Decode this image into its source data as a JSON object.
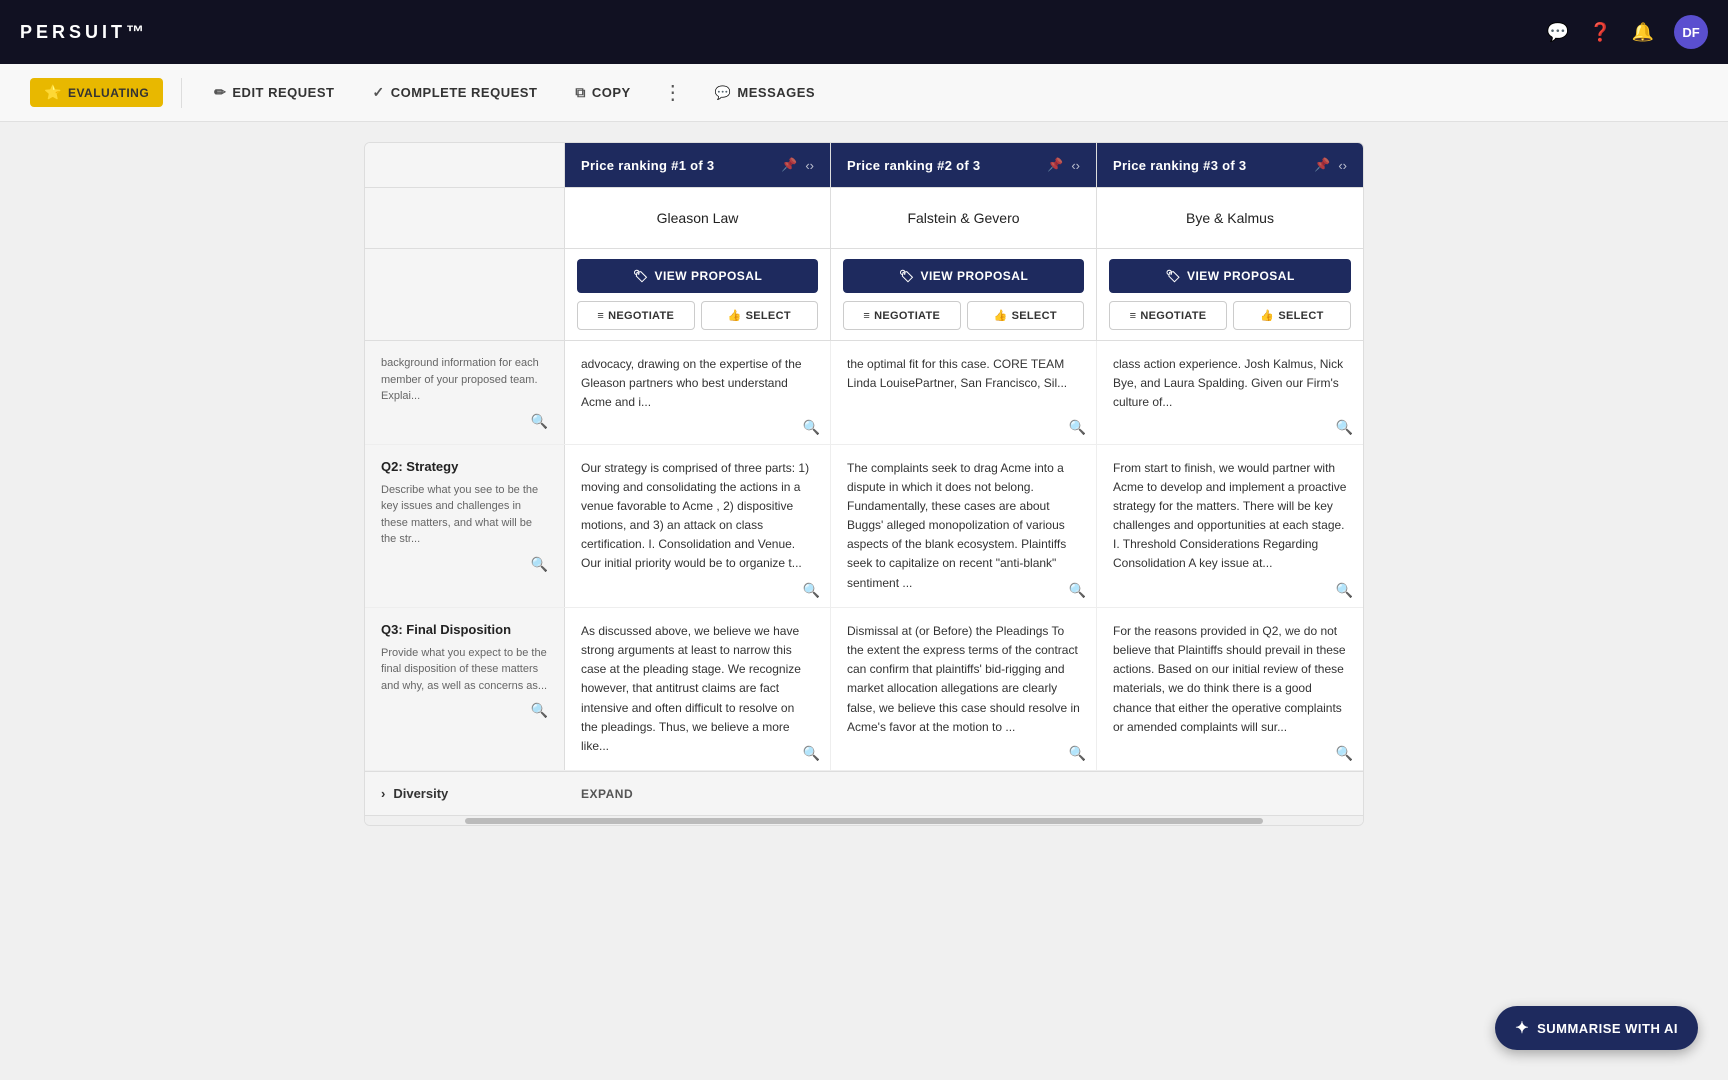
{
  "topbar": {
    "logo": "PERSUIT™",
    "icons": [
      "chat-icon",
      "help-icon",
      "notifications-icon"
    ],
    "avatar_initials": "DF"
  },
  "actionbar": {
    "status_badge": "EVALUATING",
    "edit_request_label": "EDIT REQUEST",
    "complete_request_label": "COMPLETE REQUEST",
    "copy_label": "COPY",
    "messages_label": "MESSAGES"
  },
  "columns": [
    {
      "ranking": "Price ranking #1 of 3",
      "firm": "Gleason Law",
      "q1_text": "advocacy, drawing on the expertise of the Gleason partners who best understand Acme and i...",
      "q2_text": "Our strategy is comprised of three parts: 1) moving and consolidating the actions in a venue favorable to Acme , 2) dispositive motions, and 3) an attack on class certification. I. Consolidation and Venue.  Our initial priority would be to organize t...",
      "q3_text": "As discussed above, we believe we have strong arguments at least to narrow this case at the pleading stage.  We recognize however, that antitrust claims are fact intensive and often difficult to resolve on the pleadings.  Thus, we believe a more like..."
    },
    {
      "ranking": "Price ranking #2 of 3",
      "firm": "Falstein & Gevero",
      "q1_text": "the optimal fit for this case.  CORE TEAM  Linda LouisePartner, San Francisco, Sil...",
      "q2_text": "The complaints seek to drag Acme into a dispute in which it does not belong.  Fundamentally, these cases are about Buggs' alleged monopolization of various aspects of the blank ecosystem.  Plaintiffs seek to capitalize on recent \"anti-blank\" sentiment ...",
      "q3_text": "Dismissal at (or Before) the Pleadings To the extent the express terms of the contract can confirm that plaintiffs' bid-rigging and market allocation allegations are clearly false, we believe this case should resolve in Acme's favor at the motion to ..."
    },
    {
      "ranking": "Price ranking #3 of 3",
      "firm": "Bye & Kalmus",
      "q1_text": "class action experience.  Josh Kalmus, Nick Bye, and Laura Spalding.  Given our Firm's culture of...",
      "q2_text": "From start to finish, we would partner with Acme to develop and implement a proactive strategy for the matters.  There will be key challenges and opportunities at each stage.   I.    Threshold Considerations Regarding Consolidation  A key issue at...",
      "q3_text": "For the reasons provided in Q2, we do not believe that Plaintiffs should prevail in these actions.  Based on our initial review of these materials, we do think there is a good chance that either the operative complaints or amended complaints will sur..."
    }
  ],
  "rows": [
    {
      "id": "q2",
      "label_title": "Q2: Strategy",
      "label_desc": "Describe what you see to be the key issues and challenges in these matters, and what will be the str..."
    },
    {
      "id": "q3",
      "label_title": "Q3: Final Disposition",
      "label_desc": "Provide what you expect to be the final disposition of these matters and why, as well as concerns as..."
    }
  ],
  "buttons": {
    "view_proposal": "VIEW PROPOSAL",
    "negotiate": "NEGOTIATE",
    "select": "SELECT",
    "expand": "EXPAND",
    "diversity_label": "Diversity",
    "summarise_ai": "SUMMARISE WITH AI"
  },
  "icons": {
    "pin": "📌",
    "zoom": "🔍",
    "edit_pencil": "✏",
    "check_circle": "✓",
    "copy": "⧉",
    "more": "⋮",
    "messages": "💬",
    "tag": "🏷",
    "thumbs_up": "👍",
    "equals": "≡",
    "ai_star": "✦",
    "chevron_right": "›",
    "nav_arrows": "‹›"
  }
}
